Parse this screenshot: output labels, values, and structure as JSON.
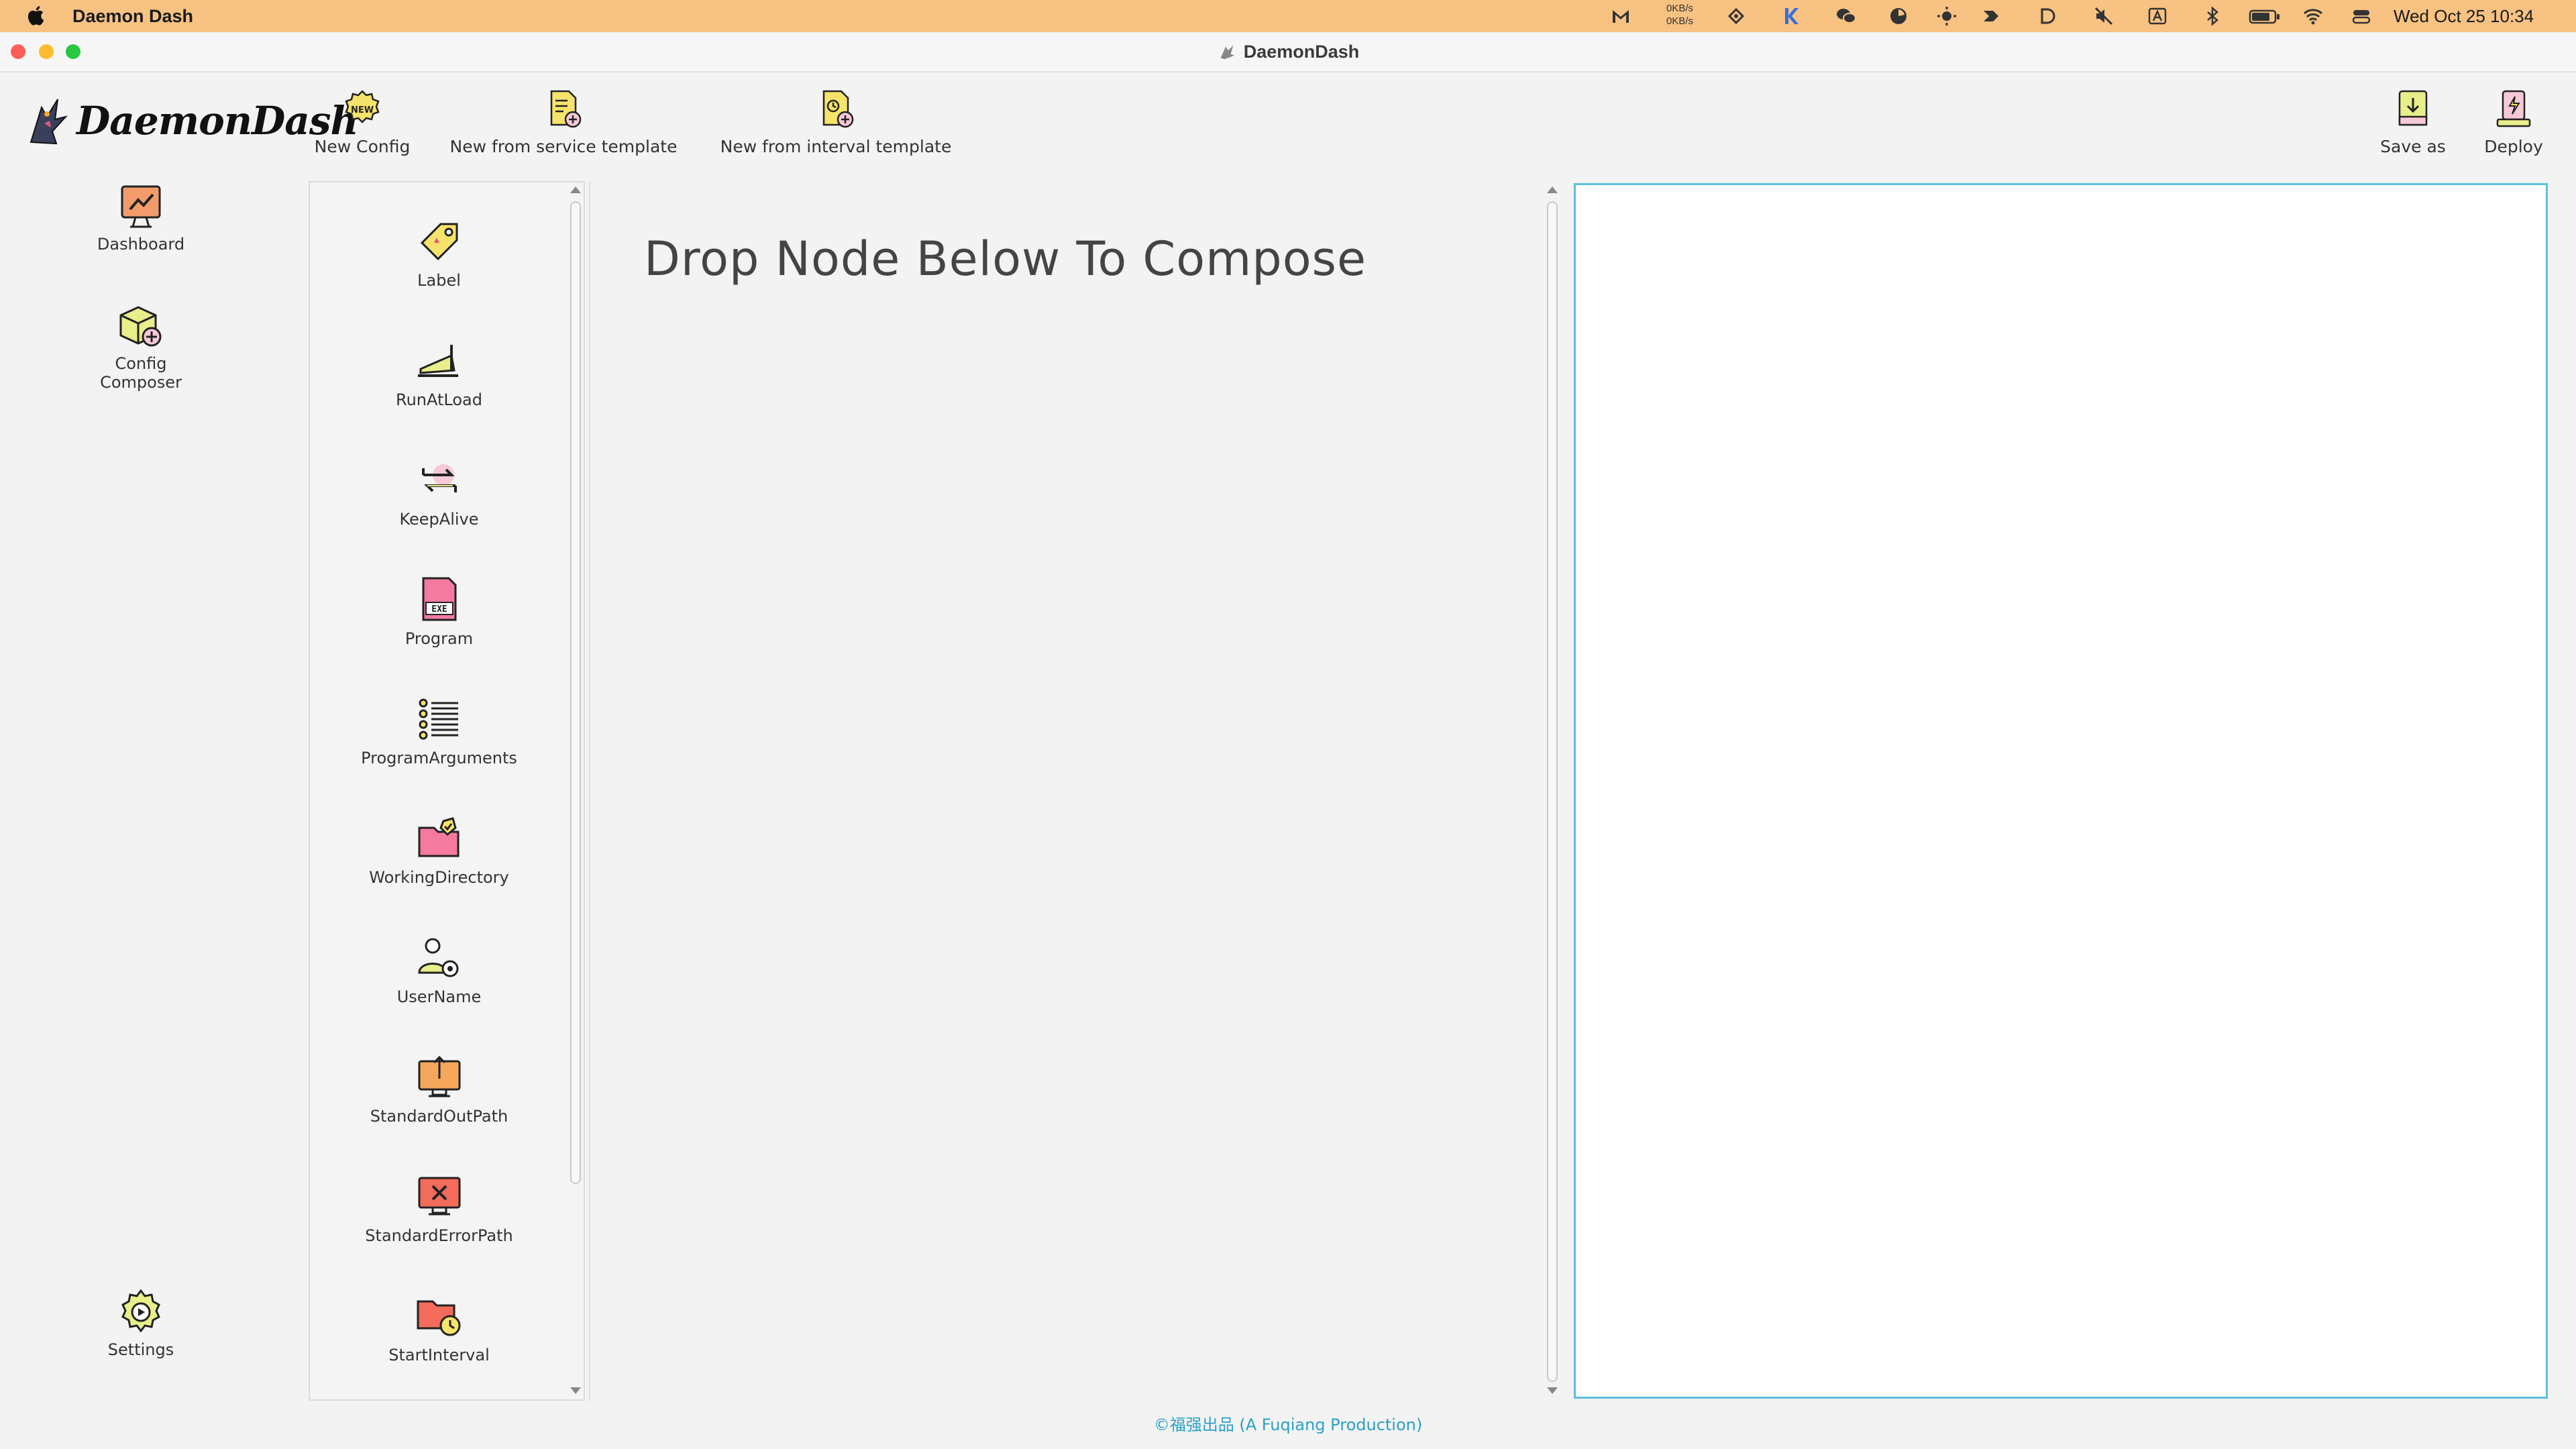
{
  "menubar": {
    "app_name": "Daemon Dash",
    "net_up": "0KB/s",
    "net_down": "0KB/s",
    "clock": "Wed Oct 25  10:34",
    "bg_color": "#f7c282"
  },
  "window": {
    "title": "DaemonDash"
  },
  "brand": {
    "name": "DaemonDash"
  },
  "nav": {
    "items": [
      {
        "label": "Dashboard",
        "icon": "dashboard-icon"
      },
      {
        "label": "Config Composer",
        "icon": "config-composer-icon"
      }
    ],
    "settings_label": "Settings"
  },
  "toolbar": {
    "new_config": "New Config",
    "new_service": "New from service template",
    "new_interval": "New from interval template",
    "save_as": "Save as",
    "deploy": "Deploy"
  },
  "palette": {
    "nodes": [
      {
        "label": "Label",
        "icon": "tag-icon"
      },
      {
        "label": "RunAtLoad",
        "icon": "treadmill-icon"
      },
      {
        "label": "KeepAlive",
        "icon": "loop-arrows-icon"
      },
      {
        "label": "Program",
        "icon": "exe-file-icon"
      },
      {
        "label": "ProgramArguments",
        "icon": "list-icon"
      },
      {
        "label": "WorkingDirectory",
        "icon": "folder-check-icon"
      },
      {
        "label": "UserName",
        "icon": "user-gear-icon"
      },
      {
        "label": "StandardOutPath",
        "icon": "monitor-output-icon"
      },
      {
        "label": "StandardErrorPath",
        "icon": "monitor-error-icon"
      },
      {
        "label": "StartInterval",
        "icon": "folder-clock-icon"
      }
    ]
  },
  "compose": {
    "title": "Drop Node Below To Compose"
  },
  "footer": {
    "text": "©福强出品 (A Fuqiang Production)",
    "color": "#2aa1c4"
  },
  "colors": {
    "preview_border": "#5bc0de",
    "traffic_close": "#ff5f57",
    "traffic_min": "#febc2e",
    "traffic_max": "#28c840"
  }
}
